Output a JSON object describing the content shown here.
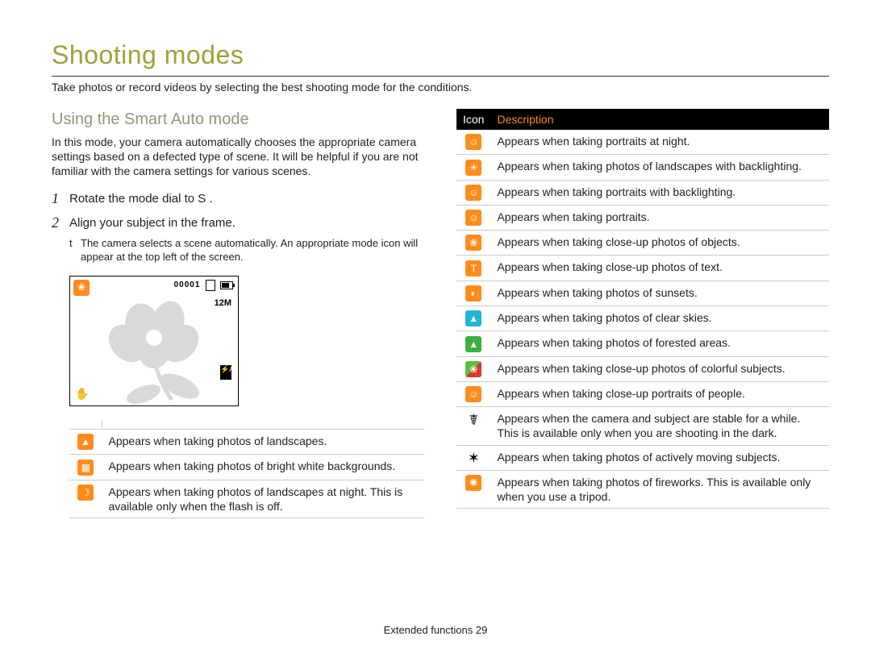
{
  "title": "Shooting modes",
  "subtitle": "Take photos or record videos by selecting the best shooting mode for the conditions.",
  "section_heading": "Using the Smart Auto mode",
  "section_paragraph": "In this mode, your camera automatically chooses the appropriate camera settings based on a defected type of scene. It will be helpful if you are not familiar with the camera settings for various scenes.",
  "steps": [
    {
      "num": "1",
      "text": "Rotate the mode dial to S       ."
    },
    {
      "num": "2",
      "text": "Align your subject in the frame."
    }
  ],
  "step2_sub_bullet": "t",
  "step2_sub": "The camera selects a scene automatically. An appropriate mode icon will appear at the top left of the screen.",
  "screenshot": {
    "counter": "00001",
    "res": "12M",
    "flash": "⚡A",
    "hand": "✋",
    "tulip": "❀"
  },
  "left_table": {
    "rows": [
      {
        "icon_name": "landscape-icon",
        "icon_bg": "bg-orange",
        "glyph": "▲",
        "desc": "Appears when taking photos of landscapes."
      },
      {
        "icon_name": "white-bg-icon",
        "icon_bg": "bg-orange",
        "glyph": "▦",
        "desc": "Appears when taking photos of bright white backgrounds."
      },
      {
        "icon_name": "night-landscape-icon",
        "icon_bg": "bg-orange",
        "glyph": "☽",
        "desc": "Appears when taking photos of landscapes at night. This is available only when the ﬂash is off."
      }
    ]
  },
  "right_table": {
    "header_icon": "Icon",
    "header_desc": "Description",
    "rows": [
      {
        "icon_name": "night-portrait-icon",
        "icon_bg": "bg-orange",
        "glyph": "☺",
        "desc": "Appears when taking portraits at night."
      },
      {
        "icon_name": "backlight-landscape-icon",
        "icon_bg": "bg-orange",
        "glyph": "☀",
        "desc": "Appears when taking photos of landscapes with backlighting."
      },
      {
        "icon_name": "backlight-portrait-icon",
        "icon_bg": "bg-orange",
        "glyph": "☺",
        "desc": "Appears when taking portraits with backlighting."
      },
      {
        "icon_name": "portrait-icon",
        "icon_bg": "bg-orange",
        "glyph": "☺",
        "desc": "Appears when taking portraits."
      },
      {
        "icon_name": "macro-object-icon",
        "icon_bg": "bg-orange",
        "glyph": "❀",
        "desc": "Appears when taking close-up photos of objects."
      },
      {
        "icon_name": "macro-text-icon",
        "icon_bg": "bg-orange",
        "glyph": "T",
        "desc": "Appears when taking close-up photos of text."
      },
      {
        "icon_name": "sunset-icon",
        "icon_bg": "bg-orange",
        "glyph": "◐",
        "desc": "Appears when taking photos of sunsets."
      },
      {
        "icon_name": "clear-sky-icon",
        "icon_bg": "bg-cyan",
        "glyph": "▲",
        "desc": "Appears when taking photos of clear skies."
      },
      {
        "icon_name": "forest-icon",
        "icon_bg": "bg-green",
        "glyph": "▲",
        "desc": "Appears when taking photos of forested areas."
      },
      {
        "icon_name": "macro-color-icon",
        "icon_bg": "split",
        "glyph": "❀",
        "desc": "Appears when taking close-up photos of colorful subjects."
      },
      {
        "icon_name": "macro-portrait-icon",
        "icon_bg": "bg-orange",
        "glyph": "☺",
        "desc": "Appears when taking close-up portraits of people."
      },
      {
        "icon_name": "tripod-dark-icon",
        "icon_bg": "",
        "glyph_plain": "☤",
        "desc": "Appears when the camera and subject are stable for a while. This is available only when you are shooting in the dark."
      },
      {
        "icon_name": "action-icon",
        "icon_bg": "",
        "glyph_plain": "✶",
        "desc": "Appears when taking photos of actively moving subjects."
      },
      {
        "icon_name": "fireworks-icon",
        "icon_bg": "bg-orange",
        "glyph": "✺",
        "desc": "Appears when taking photos of ﬁreworks. This is available only when you use a tripod."
      }
    ]
  },
  "footer_label": "Extended functions",
  "footer_page": "29"
}
